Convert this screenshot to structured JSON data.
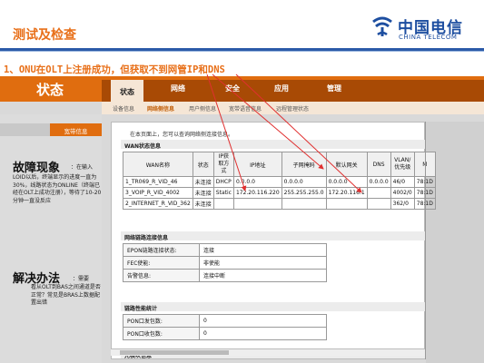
{
  "slide": {
    "title": "测试及检查",
    "subtitle": "1、ONU在OLT上注册成功，但获取不到网管IP和DNS"
  },
  "logo": {
    "cn": "中国电信",
    "en": "CHINA TELECOM",
    "mark": "china-telecom-logo"
  },
  "router": {
    "status_label": "状态",
    "tabs": [
      "状态",
      "网络",
      "安全",
      "应用",
      "管理"
    ],
    "subtabs": [
      "设备信息",
      "网络侧信息",
      "用户侧信息",
      "宽带语音信息",
      "远程管理状态"
    ],
    "active_subtab": "网络侧信息",
    "left_menu_item": "宽带信息",
    "hint": "在本页面上，您可以查询网络侧连接信息。",
    "wan": {
      "section_title": "WAN状态信息",
      "headers": [
        "WAN名称",
        "状态",
        "IP获取方式",
        "IP地址",
        "子网掩码",
        "默认网关",
        "DNS",
        "VLAN/优先级",
        "M"
      ],
      "rows": [
        [
          "1_TR069_R_VID_46",
          "未连接",
          "DHCP",
          "0.0.0.0",
          "0.0.0.0",
          "0.0.0.0",
          "0.0.0.0",
          "46/0",
          "78:1D"
        ],
        [
          "3_VOIP_R_VID_4002",
          "未连接",
          "Static",
          "172.20.116.220",
          "255.255.255.0",
          "172.20.116.1",
          "",
          "4002/0",
          "78:1D"
        ],
        [
          "2_INTERNET_R_VID_362",
          "未连接",
          "",
          "",
          "",
          "",
          "",
          "362/0",
          "78:1D"
        ]
      ]
    },
    "link": {
      "section_title": "网络链路连接信息",
      "rows": [
        {
          "k": "EPON链路连接状态:",
          "v": "连接"
        },
        {
          "k": "FEC使能:",
          "v": "非使能"
        },
        {
          "k": "告警信息:",
          "v": "连接中断"
        }
      ]
    },
    "perf": {
      "section_title": "链路性能统计",
      "rows": [
        {
          "k": "PON口发包数:",
          "v": "0"
        },
        {
          "k": "PON口收包数:",
          "v": "0"
        }
      ]
    },
    "last_section": "光模块信息"
  },
  "notes": {
    "phenomenon_title": "故障现象",
    "phenomenon_lead": "：在输入",
    "phenomenon_text": "LOID以后，终端显示的进度一直为30%，线路状态为ONLINE（终端已经在OLT上成功注册），等待了10-20分钟一直没反应",
    "solution_title": "解决办法",
    "solution_lead": "：需要",
    "solution_text": "看从OLT到BAS之间通道是否正常？常见是BRAS上数据配置出错"
  },
  "colors": {
    "orange": "#e06d0f",
    "accent_text": "#e8701a",
    "blue": "#1d4ea0",
    "arrow": "#e03030"
  }
}
